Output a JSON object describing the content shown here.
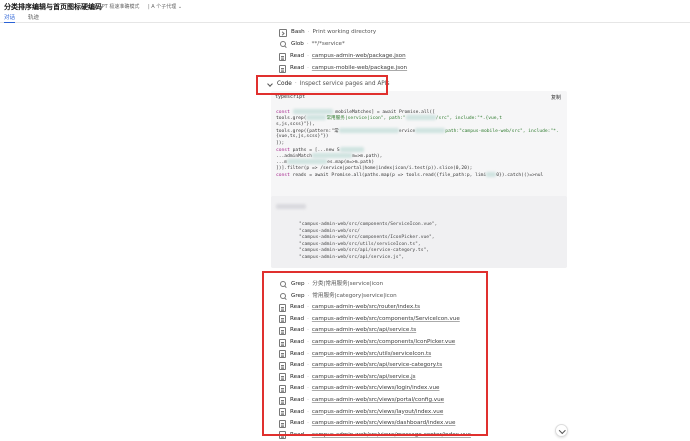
{
  "header": {
    "title": "分类排序编辑与首页图标硬编码",
    "mode": "GPT 极速准确模式",
    "agents": "A 个子代理"
  },
  "tabs": [
    {
      "label": "对话",
      "active": true
    },
    {
      "label": "轨迹",
      "active": false
    }
  ],
  "top_steps": [
    {
      "icon": "terminal-icon",
      "tool": "Bash",
      "target": "Print working directory",
      "link": false
    },
    {
      "icon": "search-icon",
      "tool": "Glob",
      "target": "**/*service*",
      "link": false
    },
    {
      "icon": "file-icon",
      "tool": "Read",
      "target": "campus-admin-web/package.json",
      "link": true
    },
    {
      "icon": "file-icon",
      "tool": "Read",
      "target": "campus-mobile-web/package.json",
      "link": true
    }
  ],
  "code_step": {
    "tool": "Code",
    "title": "Inspect service pages and APIs",
    "language": "typescript",
    "copy_label": "复制",
    "lines": [
      {
        "pre": "",
        "kw": "const",
        "text": " ",
        "redacted": 40,
        "tail": " mobileMatches] = await Promise.all(["
      },
      {
        "pre": "  tools.grep(",
        "kw": "",
        "text": "",
        "redacted": 20,
        "tail": "常用服务|service|icon\", path:\"",
        "redacted2": 30,
        "tail2": "/src\", include:\"*.{vue,t"
      },
      {
        "pre": "s,js,scss}\"}),",
        "kw": "",
        "text": "",
        "redacted": 0,
        "tail": ""
      },
      {
        "pre": "  tools.grep({pattern:\"常",
        "kw": "",
        "text": "",
        "redacted": 60,
        "tail": "ervice",
        "redacted2": 30,
        "tail2": "path:\"campus-mobile-web/src\", include:\"*."
      },
      {
        "pre": "{vue,ts,js,scss}\"})",
        "kw": "",
        "text": "",
        "redacted": 0,
        "tail": ""
      },
      {
        "pre": "]);",
        "kw": "",
        "text": "",
        "redacted": 0,
        "tail": ""
      },
      {
        "pre": "",
        "kw": "const",
        "text": " paths = [...new S",
        "redacted": 24,
        "tail": ""
      },
      {
        "pre": "  ...adminMatch",
        "kw": "",
        "text": "",
        "redacted": 40,
        "tail": "m=>m.path),"
      },
      {
        "pre": "  ...m",
        "kw": "",
        "text": "",
        "redacted": 40,
        "tail": "es.map(m=>m.path)"
      },
      {
        "pre": "])].filter(p => /service|portal|home|index|icon/i.test(p)).slice(0,",
        "kw": "",
        "text": "",
        "redacted": 0,
        "tail": "20);"
      },
      {
        "pre": "",
        "kw": "const",
        "text": " reads = await Promise.all(paths.map(p => tools.read({file_path:p, limi",
        "redacted": 10,
        "tail": "0}).catch(()=>nul"
      }
    ],
    "output_lines": [
      "\"campus-admin-web/src/components/ServiceIcon.vue\",",
      "\"campus-admin-web/src/",
      "\"campus-admin-web/src/components/IconPicker.vue\",",
      "\"campus-admin-web/src/utils/serviceIcon.ts\",",
      "\"campus-admin-web/src/api/service-category.ts\",",
      "\"campus-admin-web/src/api/service.js\","
    ]
  },
  "bottom_steps": [
    {
      "icon": "search-icon",
      "tool": "Grep",
      "target": "分类|常用服务|service|icon",
      "link": false
    },
    {
      "icon": "search-icon",
      "tool": "Grep",
      "target": "常用服务|category|service|icon",
      "link": false
    },
    {
      "icon": "file-icon",
      "tool": "Read",
      "target": "campus-admin-web/src/router/index.ts",
      "link": true
    },
    {
      "icon": "file-icon",
      "tool": "Read",
      "target": "campus-admin-web/src/components/ServiceIcon.vue",
      "link": true
    },
    {
      "icon": "file-icon",
      "tool": "Read",
      "target": "campus-admin-web/src/api/service.ts",
      "link": true
    },
    {
      "icon": "file-icon",
      "tool": "Read",
      "target": "campus-admin-web/src/components/IconPicker.vue",
      "link": true
    },
    {
      "icon": "file-icon",
      "tool": "Read",
      "target": "campus-admin-web/src/utils/serviceIcon.ts",
      "link": true
    },
    {
      "icon": "file-icon",
      "tool": "Read",
      "target": "campus-admin-web/src/api/service-category.ts",
      "link": true
    },
    {
      "icon": "file-icon",
      "tool": "Read",
      "target": "campus-admin-web/src/api/service.js",
      "link": true
    },
    {
      "icon": "file-icon",
      "tool": "Read",
      "target": "campus-admin-web/src/views/login/index.vue",
      "link": true
    },
    {
      "icon": "file-icon",
      "tool": "Read",
      "target": "campus-admin-web/src/views/portal/config.vue",
      "link": true
    },
    {
      "icon": "file-icon",
      "tool": "Read",
      "target": "campus-admin-web/src/views/layout/index.vue",
      "link": true
    },
    {
      "icon": "file-icon",
      "tool": "Read",
      "target": "campus-admin-web/src/views/dashboard/index.vue",
      "link": true
    },
    {
      "icon": "file-icon",
      "tool": "Read",
      "target": "campus-admin-web/src/views/message-center/index.vue",
      "link": true
    }
  ],
  "colors": {
    "highlight_border": "#e0302e",
    "active_tab": "#2a62d6",
    "code_bg": "#f6f6f7"
  }
}
